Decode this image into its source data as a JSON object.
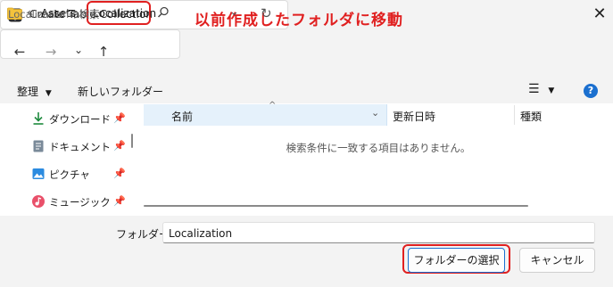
{
  "window": {
    "title": "Create Table Collection",
    "close_icon": "close-icon"
  },
  "annotations": {
    "top_note": "以前作成したフォルダに移動",
    "accent_color": "#e02020"
  },
  "nav": {
    "back": "←",
    "forward": "→",
    "dropdown": "⌄",
    "up": "↑"
  },
  "address": {
    "overflow": "«",
    "crumbs": [
      "Assets",
      "Localization"
    ],
    "separator": "›"
  },
  "search": {
    "placeholder": "Localizationの検索"
  },
  "toolbar": {
    "organize": "整理",
    "new_folder": "新しいフォルダー"
  },
  "sidebar": {
    "items": [
      {
        "label": "ダウンロード",
        "icon": "download-icon"
      },
      {
        "label": "ドキュメント",
        "icon": "document-icon"
      },
      {
        "label": "ピクチャ",
        "icon": "picture-icon"
      },
      {
        "label": "ミュージック",
        "icon": "music-icon"
      }
    ]
  },
  "columns": {
    "name": "名前",
    "modified": "更新日時",
    "type": "種類"
  },
  "empty_message": "検索条件に一致する項目はありません。",
  "footer": {
    "folder_label": "フォルダー:",
    "folder_value": "Localization",
    "select_button": "フォルダーの選択",
    "cancel_button": "キャンセル"
  }
}
